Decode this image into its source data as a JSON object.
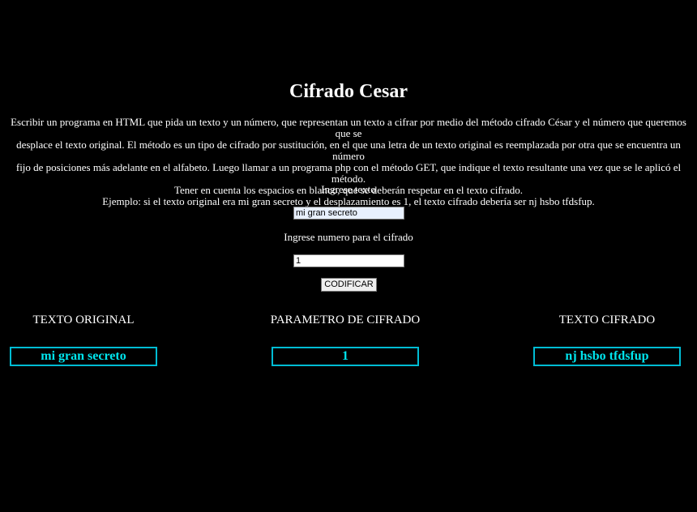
{
  "page": {
    "title": "Cifrado Cesar",
    "description_lines": [
      "Escribir un programa en HTML que pida un texto y un número, que representan un texto a cifrar por medio del método cifrado César y el número que queremos que se",
      "desplace el texto original. El método es un tipo de cifrado por sustitución, en el que una letra de un texto original es reemplazada por otra que se encuentra un número",
      "fijo de posiciones más adelante en el alfabeto. Luego llamar a un programa php con el método GET, que indique el texto resultante una vez que se le aplicó el método.",
      "Tener en cuenta los espacios en blanco, que se deberán respetar en el texto cifrado.",
      "Ejemplo: si el texto original era mi gran secreto y el desplazamiento es 1, el texto cifrado debería ser nj hsbo tfdsfup."
    ]
  },
  "form": {
    "text_label": "Ingrese texto",
    "text_value": "mi gran secreto",
    "number_label": "Ingrese numero para el cifrado",
    "number_value": "1",
    "submit_label": "CODIFICAR"
  },
  "results": {
    "original_heading": "TEXTO ORIGINAL",
    "original_value": "mi gran secreto",
    "param_heading": "PARAMETRO DE CIFRADO",
    "param_value": "1",
    "cipher_heading": "TEXTO CIFRADO",
    "cipher_value": "nj hsbo tfdsfup"
  },
  "colors": {
    "background": "#000000",
    "text": "#ffffff",
    "result_accent": "#00e5ee",
    "result_border": "#00bcd4"
  }
}
